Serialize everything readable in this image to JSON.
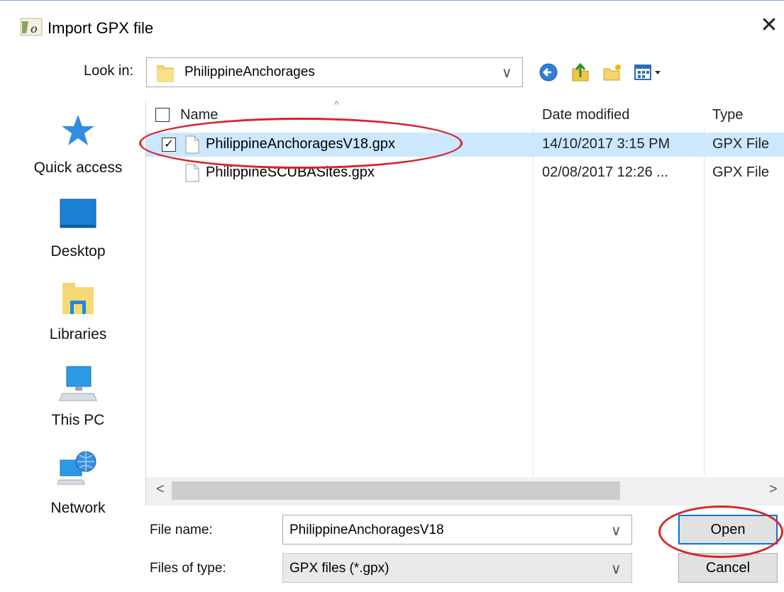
{
  "window": {
    "title": "Import GPX file",
    "close_glyph": "✕"
  },
  "lookin": {
    "label": "Look in:",
    "value": "PhilippineAnchorages",
    "chevron": "∨"
  },
  "toolbar": {
    "icons": [
      "back-icon",
      "up-folder-icon",
      "new-folder-icon",
      "view-menu-icon"
    ]
  },
  "places": [
    {
      "label": "Quick access",
      "icon": "quick-access-star-icon"
    },
    {
      "label": "Desktop",
      "icon": "desktop-icon"
    },
    {
      "label": "Libraries",
      "icon": "libraries-icon"
    },
    {
      "label": "This PC",
      "icon": "this-pc-icon"
    },
    {
      "label": "Network",
      "icon": "network-icon"
    }
  ],
  "columns": {
    "name": "Name",
    "date": "Date modified",
    "type": "Type",
    "sort_glyph": "^"
  },
  "files": [
    {
      "name": "PhilippineAnchoragesV18.gpx",
      "date": "14/10/2017 3:15 PM",
      "type": "GPX File",
      "selected": true,
      "check": "✓"
    },
    {
      "name": "PhilippineSCUBASites.gpx",
      "date": "02/08/2017 12:26 ...",
      "type": "GPX File",
      "selected": false,
      "check": ""
    }
  ],
  "scroll": {
    "left_glyph": "<",
    "right_glyph": ">"
  },
  "filename": {
    "label": "File name:",
    "value": "PhilippineAnchoragesV18",
    "chevron": "∨"
  },
  "filetype": {
    "label": "Files of type:",
    "value": "GPX files (*.gpx)",
    "chevron": "∨"
  },
  "buttons": {
    "open": "Open",
    "cancel": "Cancel"
  },
  "colors": {
    "selection": "#cce8ff",
    "annotation": "#d8232a",
    "default_button_border": "#0078d7"
  }
}
